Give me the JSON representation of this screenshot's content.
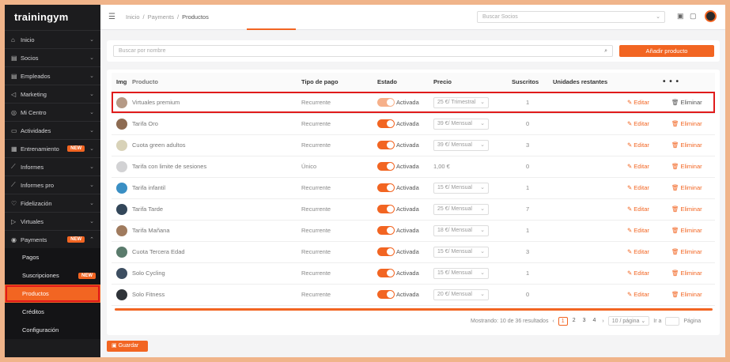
{
  "sidebar": {
    "logo": "trainingym",
    "items": [
      {
        "icon": "home-icon",
        "glyph": "⌂",
        "label": "Inicio"
      },
      {
        "icon": "id-card-icon",
        "glyph": "▤",
        "label": "Socios"
      },
      {
        "icon": "id-card-icon",
        "glyph": "▤",
        "label": "Empleados"
      },
      {
        "icon": "megaphone-icon",
        "glyph": "◁",
        "label": "Marketing"
      },
      {
        "icon": "location-icon",
        "glyph": "◎",
        "label": "Mi Centro"
      },
      {
        "icon": "calendar-icon",
        "glyph": "▭",
        "label": "Actividades"
      },
      {
        "icon": "clipboard-icon",
        "glyph": "▦",
        "label": "Entrenamiento",
        "badge": "NEW"
      },
      {
        "icon": "chart-line-icon",
        "glyph": "⟋",
        "label": "Informes"
      },
      {
        "icon": "chart-line-icon",
        "glyph": "⟋",
        "label": "Informes pro"
      },
      {
        "icon": "heart-icon",
        "glyph": "♡",
        "label": "Fidelización"
      },
      {
        "icon": "video-icon",
        "glyph": "▷",
        "label": "Virtuales"
      },
      {
        "icon": "dollar-circle-icon",
        "glyph": "◉",
        "label": "Payments",
        "badge": "NEW"
      }
    ],
    "sub_items": [
      {
        "label": "Pagos"
      },
      {
        "label": "Suscripciones",
        "badge": "NEW"
      },
      {
        "label": "Productos",
        "active": true
      },
      {
        "label": "Créditos"
      },
      {
        "label": "Configuración"
      }
    ]
  },
  "topbar": {
    "breadcrumbs": [
      "Inicio",
      "Payments",
      "Productos"
    ],
    "search_placeholder": "Buscar Socios"
  },
  "filter": {
    "search_placeholder": "Buscar por nombre",
    "add_button": "Añadir producto"
  },
  "table": {
    "columns": [
      "Img",
      "Producto",
      "Tipo de pago",
      "Estado",
      "Precio",
      "Suscritos",
      "Unidades restantes",
      "• • •"
    ],
    "edit_label": "Editar",
    "delete_label": "Eliminar",
    "rows": [
      {
        "thumb_color": "#b59a86",
        "product": "Virtuales premium",
        "payment_type": "Recurrente",
        "status": "Activada",
        "price": "25 €/ Trimestral",
        "subscribed": "1",
        "units": "",
        "highlighted": true
      },
      {
        "thumb_color": "#8d6b52",
        "product": "Tarifa Oro",
        "payment_type": "Recurrente",
        "status": "Activada",
        "price": "39 €/ Mensual",
        "subscribed": "0",
        "units": ""
      },
      {
        "thumb_color": "#d8d2b8",
        "product": "Cuota green adultos",
        "payment_type": "Recurrente",
        "status": "Activada",
        "price": "39 €/ Mensual",
        "subscribed": "3",
        "units": ""
      },
      {
        "thumb_color": "#d2d2d4",
        "product": "Tarifa con limite de sesiones",
        "payment_type": "Único",
        "status": "Activada",
        "price": "1,00 €",
        "subscribed": "0",
        "units": ""
      },
      {
        "thumb_color": "#3a8fc4",
        "product": "Tarifa infantil",
        "payment_type": "Recurrente",
        "status": "Activada",
        "price": "15 €/ Mensual",
        "subscribed": "1",
        "units": ""
      },
      {
        "thumb_color": "#33475a",
        "product": "Tarifa Tarde",
        "payment_type": "Recurrente",
        "status": "Activada",
        "price": "25 €/ Mensual",
        "subscribed": "7",
        "units": ""
      },
      {
        "thumb_color": "#a07b5e",
        "product": "Tarifa Mañana",
        "payment_type": "Recurrente",
        "status": "Activada",
        "price": "18 €/ Mensual",
        "subscribed": "1",
        "units": ""
      },
      {
        "thumb_color": "#5a7b6c",
        "product": "Cuota Tercera Edad",
        "payment_type": "Recurrente",
        "status": "Activada",
        "price": "15 €/ Mensual",
        "subscribed": "3",
        "units": ""
      },
      {
        "thumb_color": "#3d4e61",
        "product": "Solo Cycling",
        "payment_type": "Recurrente",
        "status": "Activada",
        "price": "15 €/ Mensual",
        "subscribed": "1",
        "units": ""
      },
      {
        "thumb_color": "#2f3338",
        "product": "Solo Fitness",
        "payment_type": "Recurrente",
        "status": "Activada",
        "price": "20 €/ Mensual",
        "subscribed": "0",
        "units": ""
      }
    ]
  },
  "pagination": {
    "summary": "Mostrando: 10 de 36 resultados",
    "pages": [
      "1",
      "2",
      "3",
      "4"
    ],
    "current_page": "1",
    "per_page": "10 / página",
    "goto_label": "Ir a",
    "goto_suffix": "Página"
  },
  "save_button": "Guardar",
  "colors": {
    "accent": "#f26522",
    "sidebar_bg": "#1c1c1e",
    "highlight": "#e01b1b"
  }
}
